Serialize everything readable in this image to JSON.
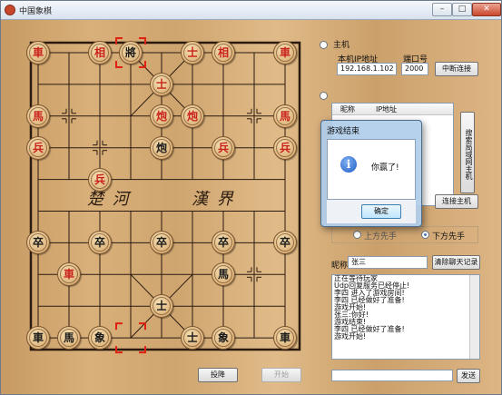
{
  "window": {
    "title": "中国象棋",
    "controls": [
      "minimize-icon",
      "maximize-icon",
      "close-icon"
    ]
  },
  "board": {
    "river_left": "楚 河",
    "river_right": "漢 界",
    "pieces": [
      {
        "char": "車",
        "side": "red",
        "col": 0,
        "row": 0
      },
      {
        "char": "相",
        "side": "red",
        "col": 2,
        "row": 0
      },
      {
        "char": "將",
        "side": "black",
        "col": 3,
        "row": 0
      },
      {
        "char": "士",
        "side": "red",
        "col": 5,
        "row": 0
      },
      {
        "char": "相",
        "side": "red",
        "col": 6,
        "row": 0
      },
      {
        "char": "車",
        "side": "red",
        "col": 8,
        "row": 0
      },
      {
        "char": "士",
        "side": "red",
        "col": 4,
        "row": 1
      },
      {
        "char": "馬",
        "side": "red",
        "col": 0,
        "row": 2
      },
      {
        "char": "炮",
        "side": "red",
        "col": 4,
        "row": 2
      },
      {
        "char": "炮",
        "side": "red",
        "col": 5,
        "row": 2
      },
      {
        "char": "馬",
        "side": "red",
        "col": 8,
        "row": 2
      },
      {
        "char": "兵",
        "side": "red",
        "col": 0,
        "row": 3
      },
      {
        "char": "炮",
        "side": "black",
        "col": 4,
        "row": 3
      },
      {
        "char": "兵",
        "side": "red",
        "col": 6,
        "row": 3
      },
      {
        "char": "兵",
        "side": "red",
        "col": 8,
        "row": 3
      },
      {
        "char": "兵",
        "side": "red",
        "col": 2,
        "row": 4
      },
      {
        "char": "卒",
        "side": "black",
        "col": 0,
        "row": 6
      },
      {
        "char": "卒",
        "side": "black",
        "col": 2,
        "row": 6
      },
      {
        "char": "卒",
        "side": "black",
        "col": 4,
        "row": 6
      },
      {
        "char": "卒",
        "side": "black",
        "col": 6,
        "row": 6
      },
      {
        "char": "卒",
        "side": "black",
        "col": 8,
        "row": 6
      },
      {
        "char": "車",
        "side": "red",
        "col": 1,
        "row": 7
      },
      {
        "char": "馬",
        "side": "black",
        "col": 6,
        "row": 7
      },
      {
        "char": "士",
        "side": "black",
        "col": 4,
        "row": 8
      },
      {
        "char": "車",
        "side": "black",
        "col": 0,
        "row": 9
      },
      {
        "char": "馬",
        "side": "black",
        "col": 1,
        "row": 9
      },
      {
        "char": "象",
        "side": "black",
        "col": 2,
        "row": 9
      },
      {
        "char": "士",
        "side": "black",
        "col": 5,
        "row": 9
      },
      {
        "char": "象",
        "side": "black",
        "col": 6,
        "row": 9
      },
      {
        "char": "車",
        "side": "black",
        "col": 8,
        "row": 9
      }
    ],
    "selection_markers": [
      {
        "col": 3,
        "row": 0
      },
      {
        "col": 3,
        "row": 9
      }
    ]
  },
  "host": {
    "label": "主机",
    "ip_label": "本机IP地址",
    "port_label": "端口号",
    "ip_value": "192.168.1.102",
    "port_value": "2000",
    "disconnect_label": "中断连接"
  },
  "client": {
    "nickname_header": "昵称",
    "ip_header": "IP地址",
    "search_label": "搜索局域网主机",
    "connect_label": "连接主机"
  },
  "first_move": {
    "top_label": "上方先手",
    "bottom_label": "下方先手",
    "selected": "bottom"
  },
  "chat": {
    "nickname_label": "昵称:",
    "nickname_value": "张三",
    "clear_label": "清除聊天记录",
    "log": [
      "正在等待玩家",
      "Udp回复服务已经停止!",
      "李四 进入了游戏房间!",
      "李四 已经做好了准备!",
      "游戏开始!",
      "张三:你好!",
      "游戏结束!",
      "李四 已经做好了准备!",
      "游戏开始!"
    ],
    "input_value": "",
    "send_label": "发送"
  },
  "game_buttons": {
    "resign_label": "投降",
    "start_label": "开始"
  },
  "dialog": {
    "title": "游戏结束",
    "message": "你赢了!",
    "ok_label": "确定"
  }
}
